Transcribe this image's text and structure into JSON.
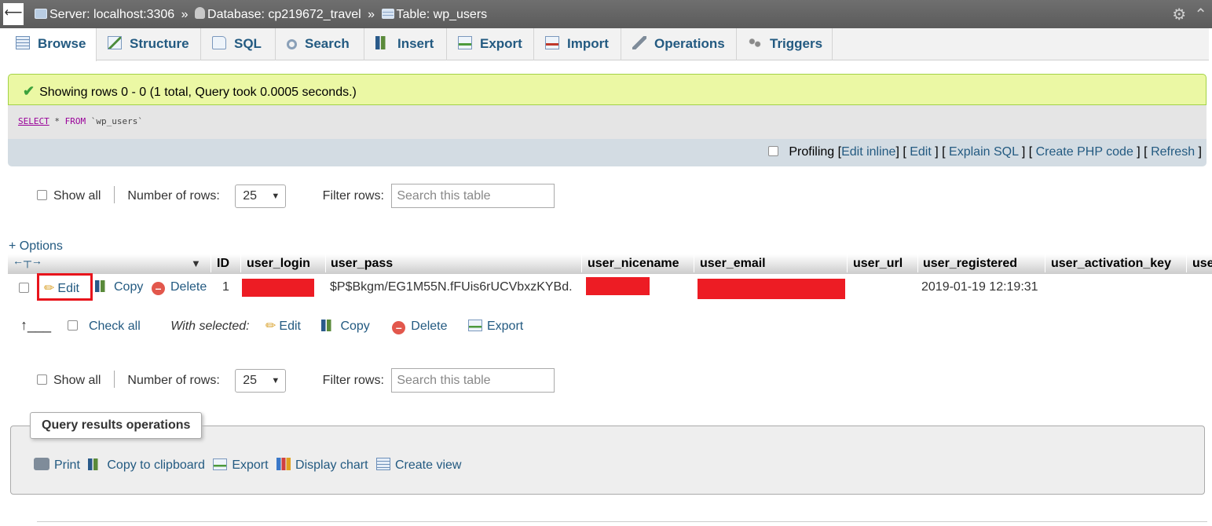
{
  "breadcrumb": {
    "back": "⟵",
    "server": "Server: localhost:3306",
    "database": "Database: cp219672_travel",
    "table": "Table: wp_users",
    "separator": "»"
  },
  "tabs": [
    {
      "label": "Browse",
      "active": true
    },
    {
      "label": "Structure"
    },
    {
      "label": "SQL"
    },
    {
      "label": "Search"
    },
    {
      "label": "Insert"
    },
    {
      "label": "Export"
    },
    {
      "label": "Import"
    },
    {
      "label": "Operations"
    },
    {
      "label": "Triggers"
    }
  ],
  "message": {
    "text": "Showing rows 0 - 0 (1 total, Query took 0.0005 seconds.)",
    "success_color": "#3ca13c"
  },
  "sql": {
    "select": "SELECT",
    "star": "*",
    "from": "FROM",
    "table": "`wp_users`"
  },
  "sql_links": {
    "profiling": "Profiling",
    "edit_inline": "Edit inline",
    "edit": "Edit",
    "explain": "Explain SQL",
    "create_php": "Create PHP code",
    "refresh": "Refresh"
  },
  "nav": {
    "show_all": "Show all",
    "rows_label": "Number of rows:",
    "rows_value": "25",
    "filter_label": "Filter rows:",
    "filter_placeholder": "Search this table"
  },
  "options_label": "+ Options",
  "columns": [
    "ID",
    "user_login",
    "user_pass",
    "user_nicename",
    "user_email",
    "user_url",
    "user_registered",
    "user_activation_key",
    "use"
  ],
  "row": {
    "edit": "Edit",
    "copy": "Copy",
    "delete": "Delete",
    "id": "1",
    "user_pass": "$P$Bkgm/EG1M55N.fFUis6rUCVbxzKYBd.",
    "user_registered": "2019-01-19 12:19:31",
    "redaction_color": "#ed1c24"
  },
  "bulk": {
    "check_all": "Check all",
    "with_selected": "With selected:",
    "edit": "Edit",
    "copy": "Copy",
    "delete": "Delete",
    "export": "Export"
  },
  "qro": {
    "title": "Query results operations",
    "print": "Print",
    "copy_clipboard": "Copy to clipboard",
    "export": "Export",
    "display_chart": "Display chart",
    "create_view": "Create view"
  },
  "colors": {
    "link": "#235a81",
    "highlight_box": "#e8141c"
  }
}
